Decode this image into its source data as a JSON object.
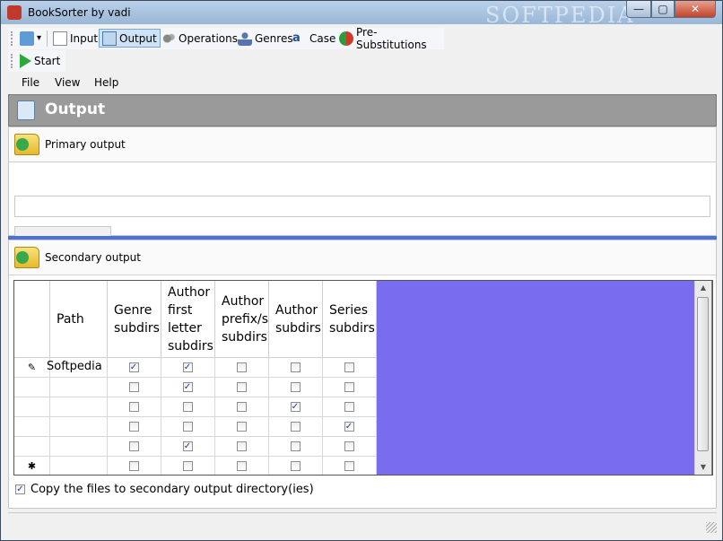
{
  "window": {
    "title": "BookSorter by vadi",
    "watermark": "SOFTPEDIA",
    "minimize": "—",
    "maximize": "▢",
    "close": "✕"
  },
  "toolbar": {
    "items": [
      {
        "label": "Input",
        "icon": "input-icon"
      },
      {
        "label": "Output",
        "icon": "output-icon",
        "active": true
      },
      {
        "label": "Operations",
        "icon": "gears-icon"
      },
      {
        "label": "Genres",
        "icon": "genres-icon"
      },
      {
        "label": "Case",
        "icon": "case-icon"
      },
      {
        "label": "Pre-Substitutions",
        "icon": "presub-icon"
      }
    ],
    "start_label": "Start",
    "view_dropdown_arrow": "▾"
  },
  "menu": {
    "file": "File",
    "view": "View",
    "help": "Help"
  },
  "header": {
    "title": "Output"
  },
  "primary": {
    "title": "Primary output",
    "path_value": ""
  },
  "secondary": {
    "title": "Secondary output",
    "columns": {
      "path": "Path",
      "genre": "Genre\nsubdirs?",
      "author_first": "Author\nfirst\nletter\nsubdirs?",
      "author_prefix": "Author\nprefix/s\nsubdirs?",
      "author": "Author\nsubdirs?",
      "series": "Series\nsubdirs?"
    },
    "rows": [
      {
        "marker": "✎",
        "path": "Softpedia",
        "checks": [
          true,
          true,
          false,
          false,
          false
        ]
      },
      {
        "marker": "",
        "path": "",
        "checks": [
          false,
          true,
          false,
          false,
          false
        ]
      },
      {
        "marker": "",
        "path": "",
        "checks": [
          false,
          false,
          false,
          true,
          false
        ]
      },
      {
        "marker": "",
        "path": "",
        "checks": [
          false,
          false,
          false,
          false,
          true
        ]
      },
      {
        "marker": "",
        "path": "",
        "checks": [
          false,
          true,
          false,
          false,
          false
        ]
      },
      {
        "marker": "✱",
        "path": "",
        "checks": [
          false,
          false,
          false,
          false,
          false
        ]
      }
    ],
    "copy_label": "Copy the files to secondary output directory(ies)",
    "copy_checked": true,
    "check_glyph": "✓"
  },
  "colors": {
    "grid_empty": "#7a6cee",
    "splitter": "#4d6fd6",
    "header_bg": "#9a9a9a"
  }
}
